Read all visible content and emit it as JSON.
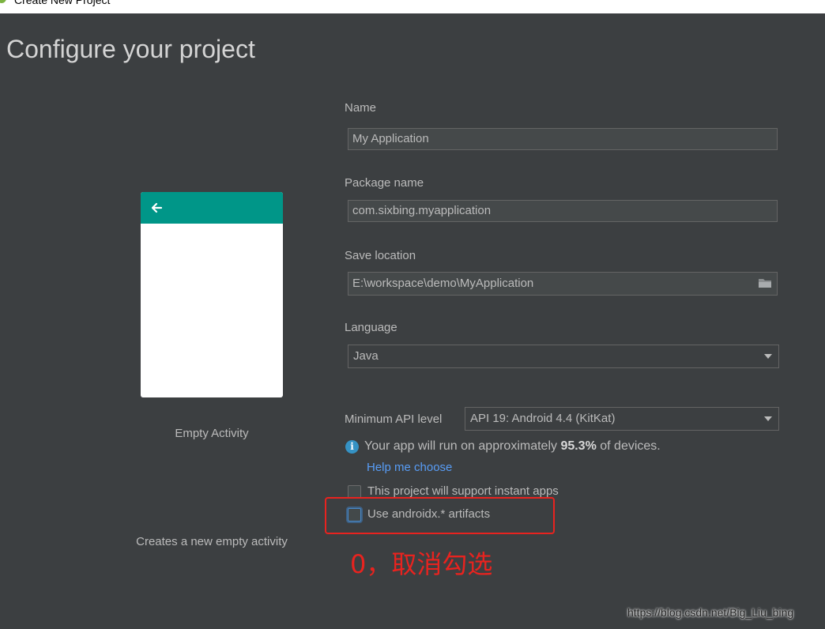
{
  "window": {
    "title": "Create New Project"
  },
  "page": {
    "heading": "Configure your project"
  },
  "template": {
    "name": "Empty Activity",
    "description": "Creates a new empty activity",
    "toolbar_color": "#009688"
  },
  "form": {
    "name_label": "Name",
    "name_value": "My Application",
    "package_label": "Package name",
    "package_value": "com.sixbing.myapplication",
    "location_label": "Save location",
    "location_value": "E:\\workspace\\demo\\MyApplication",
    "language_label": "Language",
    "language_value": "Java",
    "min_api_label": "Minimum API level",
    "min_api_value": "API 19: Android 4.4 (KitKat)",
    "info_prefix": "Your app will run on approximately ",
    "info_percent": "95.3%",
    "info_suffix": " of devices.",
    "help_link": "Help me choose",
    "instant_apps_label": "This project will support instant apps",
    "instant_apps_checked": false,
    "androidx_label": "Use androidx.* artifacts",
    "androidx_checked": false
  },
  "annotation": {
    "text": "0，取消勾选",
    "color": "#e8231f"
  },
  "watermark": "https://blog.csdn.net/Big_Liu_bing",
  "icons": [
    "back-arrow-icon",
    "folder-icon",
    "dropdown-caret-icon",
    "info-icon"
  ],
  "colors": {
    "background": "#3c3f41",
    "link": "#589df6",
    "accent": "#3592c4"
  }
}
